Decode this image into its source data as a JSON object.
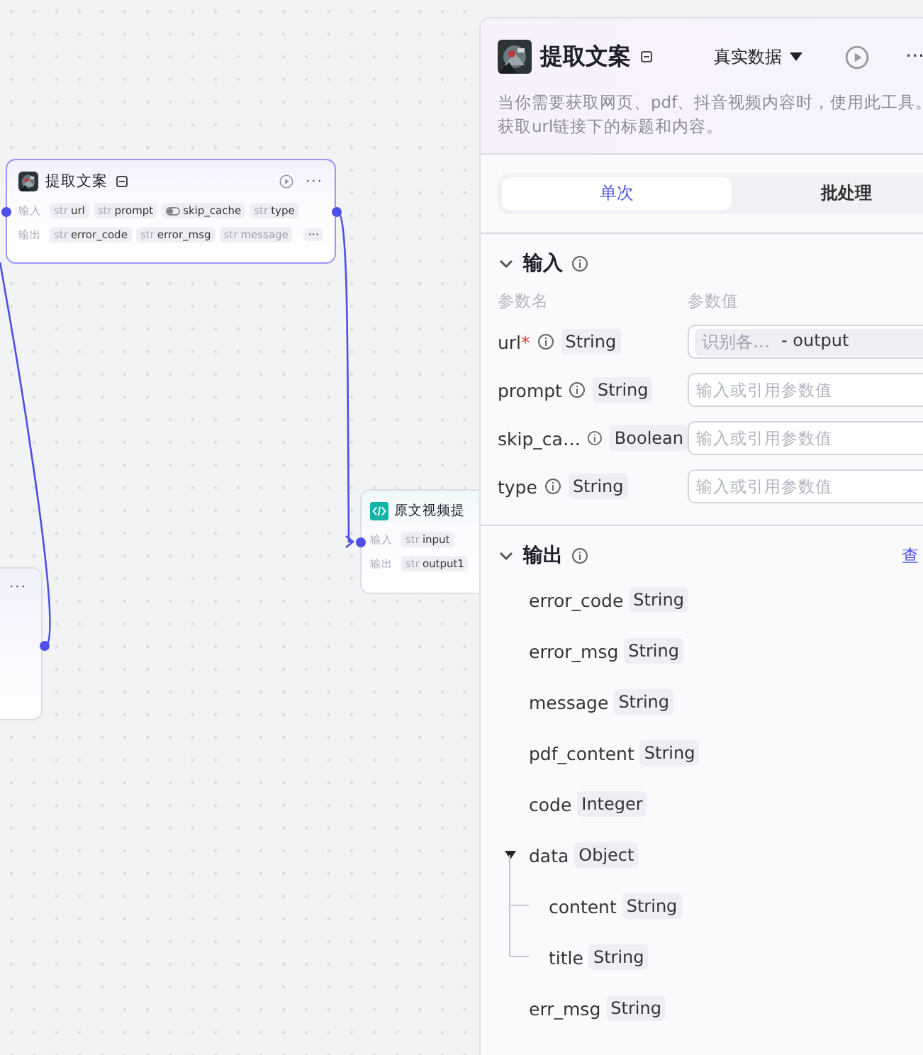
{
  "canvas": {
    "nodes": [
      {
        "kind": "tool",
        "title": "提取文案",
        "menu": "···",
        "input_label": "输入",
        "inputs": [
          {
            "kind": "string",
            "tag": "str",
            "name": "url"
          },
          {
            "kind": "string",
            "tag": "str",
            "name": "prompt"
          },
          {
            "kind": "boolean",
            "name": "skip_cache"
          },
          {
            "kind": "string",
            "tag": "str",
            "name": "type"
          }
        ],
        "output_label": "输出",
        "outputs": [
          {
            "kind": "string",
            "tag": "str",
            "name": "error_code"
          },
          {
            "kind": "string",
            "tag": "str",
            "name": "error_msg"
          },
          {
            "kind": "string",
            "tag": "str",
            "name": "message",
            "faded": true
          }
        ],
        "overflow": "···"
      },
      {
        "kind": "code",
        "title": "原文视频提",
        "input_label": "输入",
        "inputs": [
          {
            "kind": "string",
            "tag": "str",
            "name": "input"
          }
        ],
        "output_label": "输出",
        "outputs": [
          {
            "kind": "string",
            "tag": "str",
            "name": "output1"
          }
        ]
      },
      {
        "kind": "partial",
        "menu": "···"
      }
    ]
  },
  "panel": {
    "title": "提取文案",
    "mode": "真实数据",
    "menu": "···",
    "description": "当你需要获取网页、pdf、抖音视频内容时，使用此工具。获取url链接下的标题和内容。",
    "tabs": [
      {
        "label": "单次",
        "selected": true
      },
      {
        "label": "批处理",
        "selected": false
      }
    ],
    "input": {
      "title": "输入",
      "expanded": true,
      "col_name": "参数名",
      "col_value": "参数值",
      "params": [
        {
          "name": "url",
          "required_mark": "*",
          "type": "String",
          "ref_source": "识别各…",
          "ref_var": "- output"
        },
        {
          "name": "prompt",
          "type": "String",
          "placeholder": "输入或引用参数值"
        },
        {
          "name": "skip_ca…",
          "type": "Boolean",
          "placeholder": "输入或引用参数值"
        },
        {
          "name": "type",
          "type": "String",
          "placeholder": "输入或引用参数值"
        }
      ]
    },
    "output": {
      "title": "输出",
      "expanded": true,
      "link": "查",
      "fields": [
        {
          "name": "error_code",
          "type": "String"
        },
        {
          "name": "error_msg",
          "type": "String"
        },
        {
          "name": "message",
          "type": "String"
        },
        {
          "name": "pdf_content",
          "type": "String"
        },
        {
          "name": "code",
          "type": "Integer"
        },
        {
          "name": "data",
          "type": "Object",
          "expanded": true,
          "children": [
            {
              "name": "content",
              "type": "String"
            },
            {
              "name": "title",
              "type": "String"
            }
          ]
        },
        {
          "name": "err_msg",
          "type": "String"
        }
      ]
    }
  }
}
